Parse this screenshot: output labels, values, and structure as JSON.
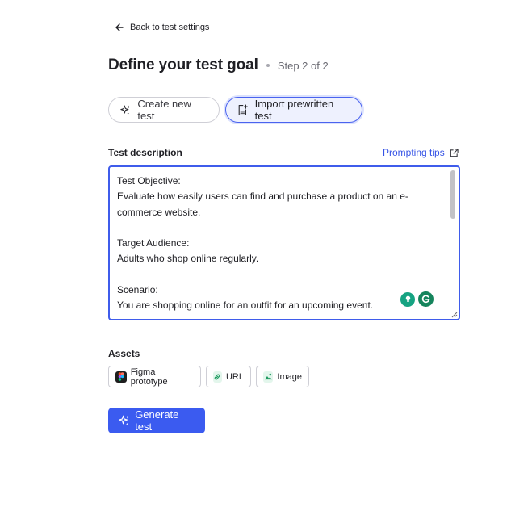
{
  "nav": {
    "back_label": "Back to test settings"
  },
  "header": {
    "title": "Define your test goal",
    "step": "Step 2 of 2"
  },
  "modes": {
    "create_label": "Create new test",
    "import_label": "Import prewritten test",
    "selected": "import"
  },
  "description": {
    "label": "Test description",
    "tips_label": "Prompting tips",
    "value": "Test Objective:\nEvaluate how easily users can find and purchase a product on an e-commerce website.\n\nTarget Audience:\nAdults who shop online regularly.\n\nScenario:\nYou are shopping online for an outfit for an upcoming event."
  },
  "assets": {
    "label": "Assets",
    "items": [
      {
        "id": "figma",
        "label": "Figma prototype",
        "icon": "figma-icon"
      },
      {
        "id": "url",
        "label": "URL",
        "icon": "link-icon"
      },
      {
        "id": "image",
        "label": "Image",
        "icon": "image-icon"
      }
    ]
  },
  "actions": {
    "generate_label": "Generate test"
  },
  "colors": {
    "accent": "#3b5bf0",
    "selected_bg": "#eef1fe",
    "grammarly": "#15845c"
  }
}
